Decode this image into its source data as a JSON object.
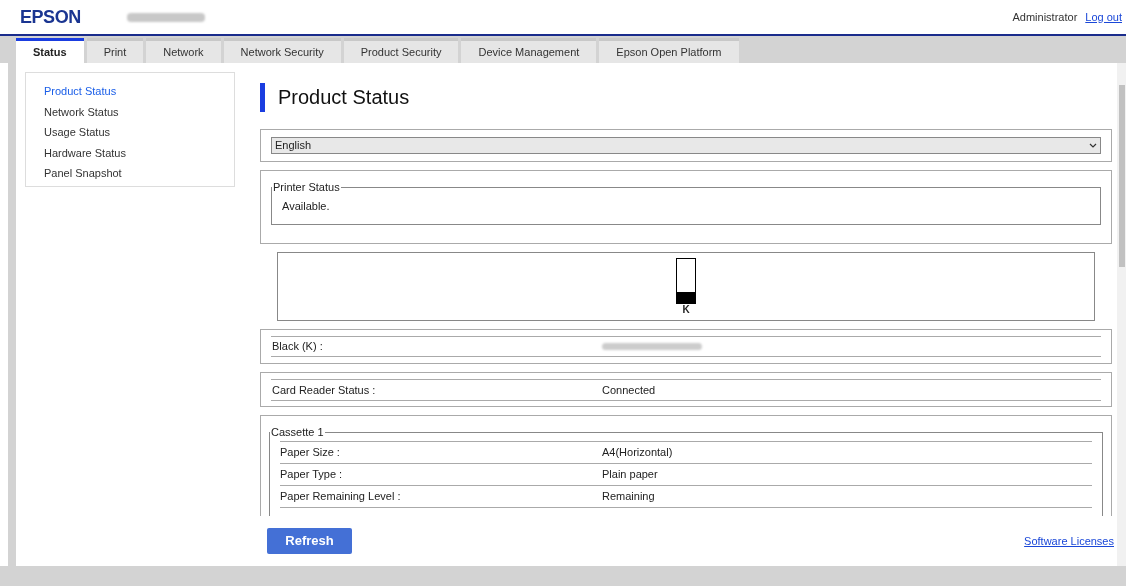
{
  "header": {
    "logo": "EPSON",
    "user": "Administrator",
    "logout": "Log out"
  },
  "tabs": [
    {
      "label": "Status",
      "selected": true
    },
    {
      "label": "Print",
      "selected": false
    },
    {
      "label": "Network",
      "selected": false
    },
    {
      "label": "Network Security",
      "selected": false
    },
    {
      "label": "Product Security",
      "selected": false
    },
    {
      "label": "Device Management",
      "selected": false
    },
    {
      "label": "Epson Open Platform",
      "selected": false
    }
  ],
  "sidebar": [
    {
      "label": "Product Status",
      "selected": true
    },
    {
      "label": "Network Status",
      "selected": false
    },
    {
      "label": "Usage Status",
      "selected": false
    },
    {
      "label": "Hardware Status",
      "selected": false
    },
    {
      "label": "Panel Snapshot",
      "selected": false
    }
  ],
  "title": "Product Status",
  "language": "English",
  "printer_status": {
    "legend": "Printer Status",
    "text": "Available."
  },
  "ink": [
    {
      "label": "K",
      "level": 0.25
    }
  ],
  "ink_info": {
    "label": "Black (K) :"
  },
  "card_reader": {
    "label": "Card Reader Status :",
    "value": "Connected"
  },
  "cassette": {
    "legend": "Cassette 1",
    "rows": [
      {
        "label": "Paper Size :",
        "value": "A4(Horizontal)"
      },
      {
        "label": "Paper Type :",
        "value": "Plain paper"
      },
      {
        "label": "Paper Remaining Level :",
        "value": "Remaining"
      }
    ]
  },
  "refresh": "Refresh",
  "software_licenses": "Software Licenses"
}
